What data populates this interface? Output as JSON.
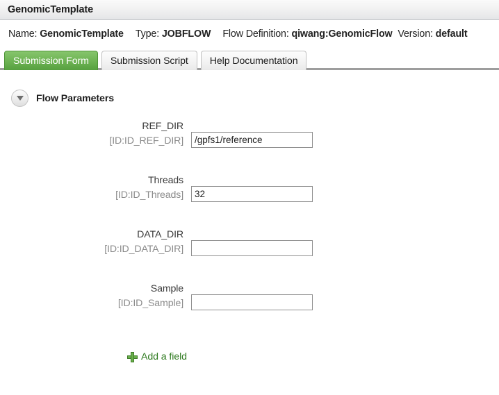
{
  "window": {
    "title": "GenomicTemplate"
  },
  "info": {
    "name_label": "Name:",
    "name_value": "GenomicTemplate",
    "type_label": "Type:",
    "type_value": "JOBFLOW",
    "flow_definition_label": "Flow Definition:",
    "flow_definition_value": "qiwang:GenomicFlow",
    "version_label": "Version:",
    "version_value": "default"
  },
  "tabs": [
    {
      "label": "Submission Form",
      "active": true
    },
    {
      "label": "Submission Script",
      "active": false
    },
    {
      "label": "Help Documentation",
      "active": false
    }
  ],
  "section": {
    "title": "Flow Parameters",
    "toggle_icon": "chevron-down-icon"
  },
  "fields": [
    {
      "name": "REF_DIR",
      "id_label": "[ID:ID_REF_DIR]",
      "value": "/gpfs1/reference",
      "placeholder": ""
    },
    {
      "name": "Threads",
      "id_label": "[ID:ID_Threads]",
      "value": "32",
      "placeholder": ""
    },
    {
      "name": "DATA_DIR",
      "id_label": "[ID:ID_DATA_DIR]",
      "value": "",
      "placeholder": ""
    },
    {
      "name": "Sample",
      "id_label": "[ID:ID_Sample]",
      "value": "",
      "placeholder": ""
    }
  ],
  "add_field": {
    "label": "Add a field",
    "icon": "plus-icon"
  },
  "colors": {
    "active_tab_green": "#6fb455",
    "add_field_green": "#2e7a1f",
    "title_bar_gray": "#f2f2f2",
    "tab_rule_gray": "#9d9d9d",
    "input_border": "#8e8e8e",
    "id_text_gray": "#8b8b8b"
  }
}
